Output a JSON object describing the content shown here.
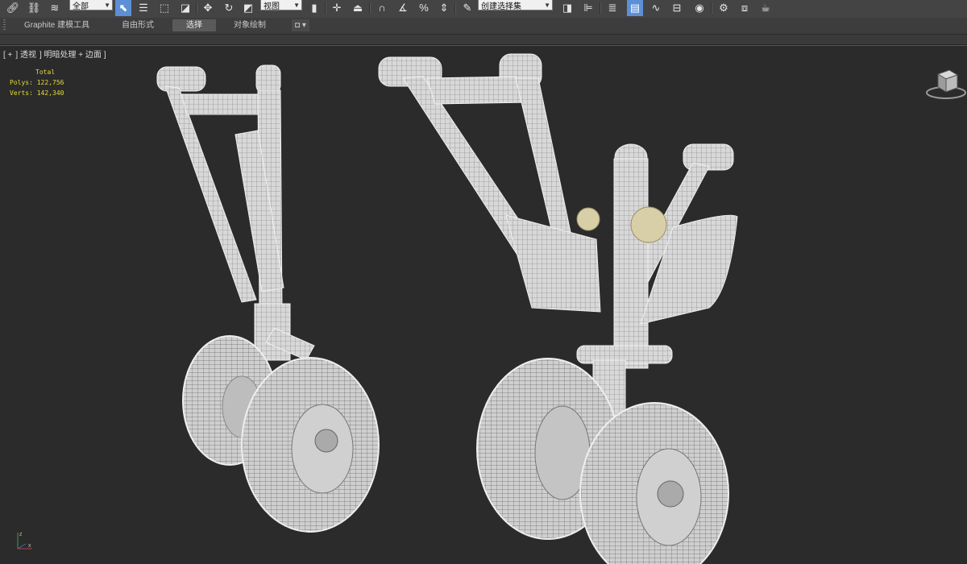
{
  "toolbar": {
    "selection_filter": "全部",
    "reference_coord": "视图",
    "named_selection": "创建选择集",
    "icons": [
      "link-icon",
      "unlink-icon",
      "bind-spacewarp-icon",
      "select-object-icon",
      "select-by-name-icon",
      "rect-selection-icon",
      "window-crossing-icon",
      "move-icon",
      "rotate-icon",
      "scale-icon",
      "pivot-center-icon",
      "select-manipulate-icon",
      "keyboard-shortcut-icon",
      "snap-3d-icon",
      "angle-snap-icon",
      "percent-snap-icon",
      "spinner-snap-icon",
      "edit-named-selection-icon",
      "mirror-icon",
      "align-icon",
      "layer-manager-icon",
      "graphite-ribbon-icon",
      "curve-editor-icon",
      "schematic-view-icon",
      "material-editor-icon",
      "render-setup-icon",
      "rendered-frame-icon",
      "render-icon"
    ]
  },
  "ribbon": {
    "tabs": [
      "Graphite 建模工具",
      "自由形式",
      "选择",
      "对象绘制"
    ],
    "active_tab": "选择",
    "menu_icon": "◘ ▾"
  },
  "viewport": {
    "label_plus": "[ +",
    "label_view": "] 透视",
    "label_shading": "] 明暗处理 + 边面 ]",
    "stats_title": "Total",
    "polys_label": "Polys:",
    "polys_value": "122,756",
    "verts_label": "Verts:",
    "verts_value": "142,340",
    "axis_x": "x",
    "axis_y": "y",
    "axis_z": "z"
  },
  "colors": {
    "stats": "#e6dc3a",
    "viewport_bg": "#2b2b2b",
    "active_tool": "#5c8fd6",
    "wire": "#c8c8c8"
  }
}
